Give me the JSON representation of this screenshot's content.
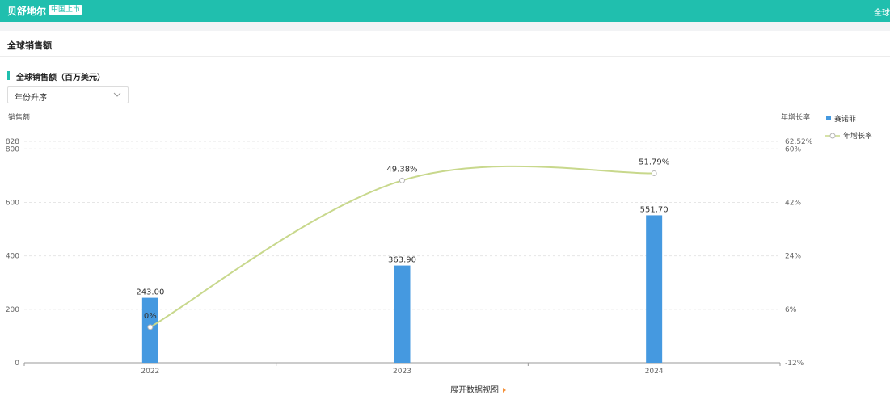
{
  "header": {
    "brand": "贝舒地尔",
    "badge": "中国上市",
    "right_text": "全球"
  },
  "section_title": "全球销售额",
  "sub_title": "全球销售额（百万美元）",
  "sort_select": {
    "value": "年份升序"
  },
  "expand_link": "展开数据视图",
  "colors": {
    "header": "#20bfae",
    "bar": "#4599e0",
    "line": "#c8d88c",
    "accent": "#20bfae",
    "expand_arrow": "#f5913a"
  },
  "chart_data": {
    "type": "bar",
    "categories": [
      "2022",
      "2023",
      "2024"
    ],
    "series": [
      {
        "name": "赛诺菲",
        "type": "bar",
        "axis": "left",
        "values": [
          243.0,
          363.9,
          551.7
        ],
        "labels": [
          "243.00",
          "363.90",
          "551.70"
        ]
      },
      {
        "name": "年增长率",
        "type": "line",
        "axis": "right",
        "values": [
          0,
          49.38,
          51.79
        ],
        "labels": [
          "0%",
          "49.38%",
          "51.79%"
        ]
      }
    ],
    "ylabel": "销售额",
    "y2label": "年增长率",
    "ylim": [
      0,
      828
    ],
    "y2lim": [
      -12,
      62.52
    ],
    "yticks": [
      0,
      200,
      400,
      600,
      800,
      828
    ],
    "y2ticks": [
      -12,
      6,
      24,
      42,
      60,
      62.52
    ],
    "ytick_labels": [
      "0",
      "200",
      "400",
      "600",
      "800",
      "828"
    ],
    "y2tick_labels": [
      "-12%",
      "6%",
      "24%",
      "42%",
      "60%",
      "62.52%"
    ],
    "legend_position": "top-right",
    "grid": true
  }
}
